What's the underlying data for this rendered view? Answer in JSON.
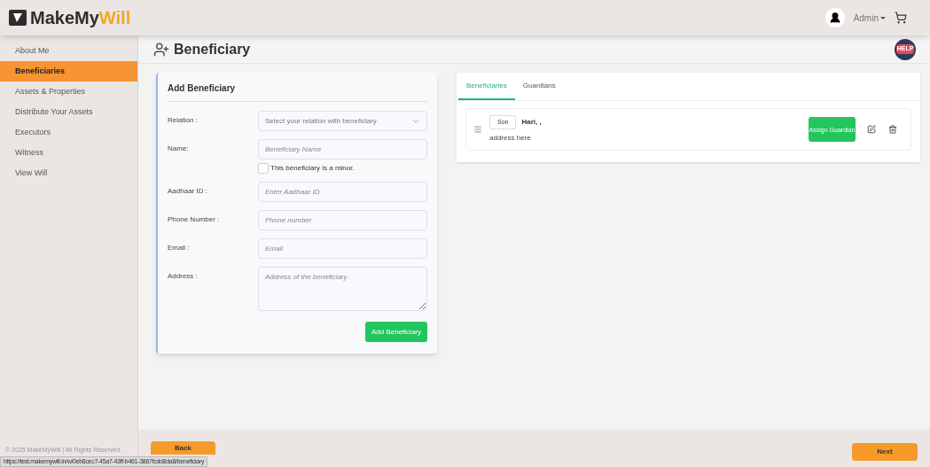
{
  "header": {
    "logo_prefix": "MakeMy",
    "logo_suffix": "Will",
    "user": "Admin"
  },
  "sidebar": {
    "items": [
      {
        "label": "About Me",
        "selected": false
      },
      {
        "label": "Beneficiaries",
        "selected": true
      },
      {
        "label": "Assets & Properties",
        "selected": false
      },
      {
        "label": "Distribute Your Assets",
        "selected": false
      },
      {
        "label": "Executors",
        "selected": false
      },
      {
        "label": "Witness",
        "selected": false
      },
      {
        "label": "View Will",
        "selected": false
      }
    ],
    "copyright": "© 2025 MakeMyWill | All Rights Reserved."
  },
  "page": {
    "title": "Beneficiary",
    "help": "HELP"
  },
  "form": {
    "title": "Add Beneficiary",
    "fields": [
      {
        "kind": "select",
        "label": "Relation :",
        "placeholder": "Select your relation with beneficiary"
      },
      {
        "kind": "text",
        "label": "Name:",
        "placeholder": "Beneficiary Name",
        "checkbox": {
          "label": "This beneficiary is a minor.",
          "checked": false
        }
      },
      {
        "kind": "text",
        "label": "Aadhaar ID :",
        "placeholder": "Enter Aadhaar ID"
      },
      {
        "kind": "text",
        "label": "Phone Number :",
        "placeholder": "Phone number"
      },
      {
        "kind": "text",
        "label": "Email :",
        "placeholder": "Email"
      },
      {
        "kind": "textarea",
        "label": "Address :",
        "placeholder": "Address of the beneficiary"
      }
    ],
    "submit": "Add Beneficiary"
  },
  "list": {
    "tabs": [
      {
        "label": "Beneficiaries",
        "selected": true
      },
      {
        "label": "Guardians",
        "selected": false
      }
    ],
    "entries": [
      {
        "relation": "Son",
        "name": "Hari, ,",
        "address": "address here",
        "action": "Assign Guardian"
      }
    ]
  },
  "footer": {
    "back": "Back",
    "next": "Next"
  },
  "status_bar": {
    "url": "https://test.makemywill.in/w/0eb8cec7-45a7-43ff-b461-3867fcdd8da8/beneficiary"
  }
}
